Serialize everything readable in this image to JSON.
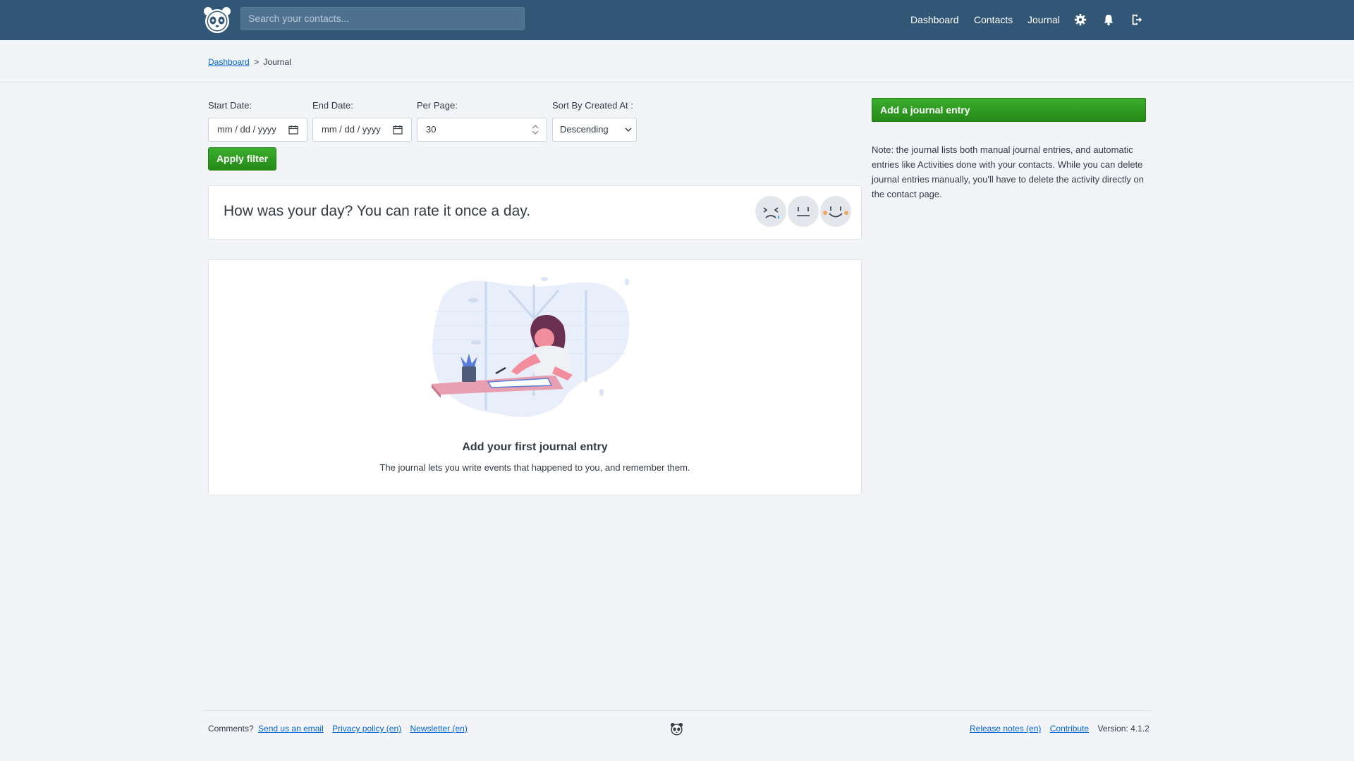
{
  "header": {
    "search_placeholder": "Search your contacts...",
    "nav": {
      "dashboard": "Dashboard",
      "contacts": "Contacts",
      "journal": "Journal"
    },
    "icons": [
      "panda-logo-icon",
      "gear-icon",
      "bell-icon",
      "logout-icon"
    ],
    "background_color": "#325776"
  },
  "breadcrumb": {
    "link": "Dashboard",
    "separator": ">",
    "current": "Journal"
  },
  "filters": {
    "start_date_label": "Start Date:",
    "start_date_value": "mm / dd / yyyy",
    "end_date_label": "End Date:",
    "end_date_value": "mm / dd / yyyy",
    "per_page_label": "Per Page:",
    "per_page_value": "30",
    "sort_label": "Sort By Created At :",
    "sort_value": "Descending",
    "apply_label": "Apply filter"
  },
  "day_rating": {
    "prompt": "How was your day? You can rate it once a day.",
    "faces": [
      "sad-face-icon",
      "neutral-face-icon",
      "happy-face-icon"
    ]
  },
  "empty_state": {
    "title": "Add your first journal entry",
    "description": "The journal lets you write events that happened to you, and remember them."
  },
  "sidebar": {
    "add_button": "Add a journal entry",
    "note": "Note: the journal lists both manual journal entries, and automatic entries like Activities done with your contacts. While you can delete journal entries manually, you'll have to delete the activity directly on the contact page."
  },
  "footer": {
    "comments": "Comments?",
    "email_link": "Send us an email",
    "privacy_link": "Privacy policy (en)",
    "newsletter_link": "Newsletter (en)",
    "release_notes_link": "Release notes (en)",
    "contribute_link": "Contribute",
    "version": "Version: 4.1.2"
  },
  "colors": {
    "accent_green": "#2e9c21",
    "link_blue": "#0366d6"
  }
}
